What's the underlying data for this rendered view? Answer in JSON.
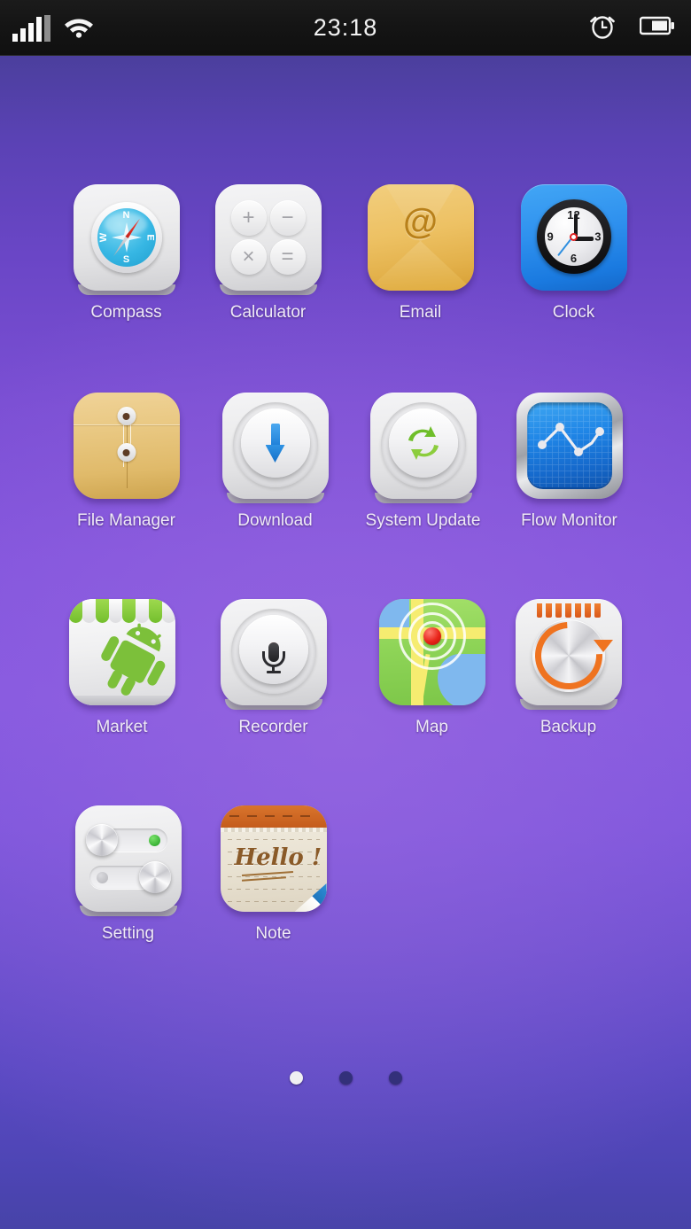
{
  "status_bar": {
    "time": "23:18",
    "signal_icon": "signal-bars-icon",
    "wifi_icon": "wifi-icon",
    "alarm_icon": "alarm-clock-icon",
    "battery_icon": "battery-icon",
    "background_color": "#141414",
    "text_color": "#f2f2f2"
  },
  "wallpaper": {
    "top_color": "#4b3f9d",
    "mid_color": "#8558e0",
    "bottom_color": "#4743a8"
  },
  "home_screen": {
    "apps": [
      {
        "label": "Compass",
        "icon": "compass-icon"
      },
      {
        "label": "Calculator",
        "icon": "calculator-icon"
      },
      {
        "label": "Email",
        "icon": "email-envelope-icon"
      },
      {
        "label": "Clock",
        "icon": "analog-clock-icon"
      },
      {
        "label": "File Manager",
        "icon": "file-folder-icon"
      },
      {
        "label": "Download",
        "icon": "download-arrow-icon"
      },
      {
        "label": "System Update",
        "icon": "sync-arrows-icon"
      },
      {
        "label": "Flow Monitor",
        "icon": "line-chart-icon"
      },
      {
        "label": "Market",
        "icon": "market-shop-icon"
      },
      {
        "label": "Recorder",
        "icon": "microphone-icon"
      },
      {
        "label": "Map",
        "icon": "map-pin-icon"
      },
      {
        "label": "Backup",
        "icon": "backup-restore-icon"
      },
      {
        "label": "Setting",
        "icon": "sliders-icon"
      },
      {
        "label": "Note",
        "icon": "notepad-icon"
      }
    ],
    "calculator_keys": [
      "+",
      "−",
      "×",
      "="
    ],
    "clock_numerals": {
      "n12": "12",
      "n3": "3",
      "n6": "6",
      "n9": "9"
    },
    "compass_letters": {
      "n": "N",
      "e": "E",
      "s": "S",
      "w": "W"
    },
    "email_symbol": "@",
    "note_text": "Hello !",
    "label_color": "#efeaf7"
  },
  "page_indicator": {
    "total_pages": 3,
    "current_page": 1,
    "active_color": "#f0f0f2",
    "inactive_color": "#33307a"
  }
}
